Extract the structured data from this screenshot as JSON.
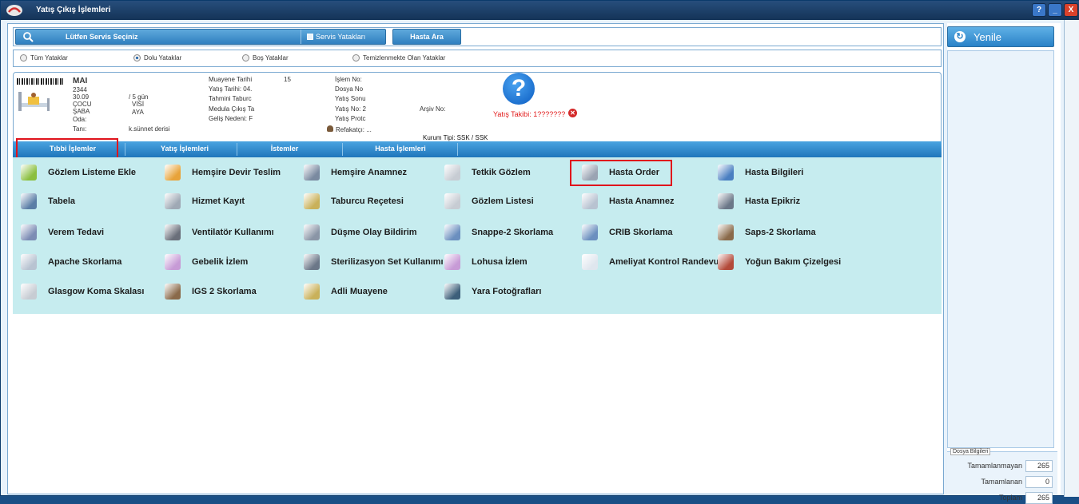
{
  "window": {
    "title": "Yatış Çıkış İşlemleri",
    "controls": [
      "?",
      "_",
      "X"
    ]
  },
  "toolbar": {
    "service_label": "Lütfen Servis Seçiniz",
    "servis_yatakan_label": "Servis Yatakları",
    "hasta_ara_label": "Hasta Ara"
  },
  "filters": [
    {
      "label": "Tüm Yataklar",
      "selected": false
    },
    {
      "label": "Dolu Yataklar",
      "selected": true
    },
    {
      "label": "Boş Yataklar",
      "selected": false
    },
    {
      "label": "Temizlenmekte Olan Yataklar",
      "selected": false
    }
  ],
  "patient": {
    "name": "MAI",
    "id": "2344",
    "date": "30.09",
    "status1": "ÇOCU",
    "status2": "ŞABA",
    "oda": "Oda:",
    "tani": "Tanı:",
    "tani_value": "k.sünnet derisi",
    "gun": "/ 5 gün",
    "visi": "VİSİ",
    "aya": "AYA",
    "muayene_tarihi": "Muayene Tarihi",
    "muayene_no": "15",
    "yatis_tarihi": "Yatış Tarihi: 04.",
    "tahmini_taburcu": "Tahmini Taburc",
    "medula_cikis": "Medula Çıkış Ta",
    "gelis_nedeni": "Geliş Nedeni: F",
    "islem_no": "İşlem No:",
    "dosya_no": "Dosya No",
    "yatis_sonu": "Yatış Sonu",
    "yatis_no": "Yatış No: 2",
    "yatis_prot": "Yatış Protc",
    "refakatci": "Refakatçı: ...",
    "arsiv_no": "Arşiv No:",
    "yatis_takibi": "Yatış Takibi: 1???????",
    "kurum_tipi": "Kurum Tipi: SSK / SSK"
  },
  "tabs": [
    {
      "label": "Tıbbi İşlemler",
      "active": true
    },
    {
      "label": "Yatış İşlemleri",
      "active": false
    },
    {
      "label": "İstemler",
      "active": false
    },
    {
      "label": "Hasta İşlemleri",
      "active": false
    }
  ],
  "actions": [
    [
      {
        "label": "Gözlem Listeme Ekle",
        "icon": "add-list-icon",
        "color": "#8bbf3f"
      },
      {
        "label": "Hemşire Devir Teslim",
        "icon": "handover-icon",
        "color": "#e8a33a"
      },
      {
        "label": "Hemşire Anamnez",
        "icon": "nurse-icon",
        "color": "#7a8aa0"
      },
      {
        "label": "Tetkik Gözlem",
        "icon": "document-icon",
        "color": "#c7ccd3"
      },
      {
        "label": "Hasta Order",
        "icon": "order-icon",
        "color": "#9aa4b3"
      },
      {
        "label": "Hasta Bilgileri",
        "icon": "patient-info-icon",
        "color": "#4a7fc1"
      }
    ],
    [
      {
        "label": "Tabela",
        "icon": "table-icon",
        "color": "#5a7ea6"
      },
      {
        "label": "Hizmet Kayıt",
        "icon": "service-record-icon",
        "color": "#9fa9b5"
      },
      {
        "label": "Taburcu Reçetesi",
        "icon": "prescription-icon",
        "color": "#c9b15a"
      },
      {
        "label": "Gözlem Listesi",
        "icon": "list-icon",
        "color": "#c7ccd3"
      },
      {
        "label": "Hasta Anamnez",
        "icon": "anamnesis-icon",
        "color": "#b8c3d1"
      },
      {
        "label": "Hasta Epikriz",
        "icon": "epicrisis-icon",
        "color": "#6b7788"
      }
    ],
    [
      {
        "label": "Verem Tedavi",
        "icon": "treatment-icon",
        "color": "#7c8cb4"
      },
      {
        "label": "Ventilatör Kullanımı",
        "icon": "ventilator-icon",
        "color": "#6a6f7a"
      },
      {
        "label": "Düşme Olay Bildirim",
        "icon": "fall-icon",
        "color": "#8a95a6"
      },
      {
        "label": "Snappe-2 Skorlama",
        "icon": "score-icon",
        "color": "#6b8fbf"
      },
      {
        "label": "CRIB Skorlama",
        "icon": "crib-icon",
        "color": "#6b8fbf"
      },
      {
        "label": "Saps-2 Skorlama",
        "icon": "saps-icon",
        "color": "#8a6a4a"
      }
    ],
    [
      {
        "label": "Apache Skorlama",
        "icon": "apache-icon",
        "color": "#b8c3d1"
      },
      {
        "label": "Gebelik İzlem",
        "icon": "pregnancy-icon",
        "color": "#c79bd6"
      },
      {
        "label": "Sterilizasyon Set Kullanımı",
        "icon": "sterilization-icon",
        "color": "#6b7788"
      },
      {
        "label": "Lohusa İzlem",
        "icon": "postpartum-icon",
        "color": "#c79bd6"
      },
      {
        "label": "Ameliyat Kontrol Randevu",
        "icon": "clock-icon",
        "color": "#dfe6ee"
      },
      {
        "label": "Yoğun Bakım Çizelgesi",
        "icon": "icu-chart-icon",
        "color": "#b34a3a"
      }
    ],
    [
      {
        "label": "Glasgow Koma Skalası",
        "icon": "glasgow-icon",
        "color": "#c7ccd3"
      },
      {
        "label": "IGS 2 Skorlama",
        "icon": "igs-icon",
        "color": "#8a6a4a"
      },
      {
        "label": "Adli Muayene",
        "icon": "forensic-icon",
        "color": "#c9b15a"
      },
      {
        "label": "Yara Fotoğrafları",
        "icon": "camera-icon",
        "color": "#3d5f7a"
      }
    ]
  ],
  "sidepanel": {
    "refresh_label": "Yenile",
    "dosya_title": "Dosya Bilgileri",
    "rows": [
      {
        "label": "Tamamlanmayan",
        "value": "265"
      },
      {
        "label": "Tamamlanan",
        "value": "0"
      },
      {
        "label": "Toplam",
        "value": "265"
      }
    ]
  }
}
